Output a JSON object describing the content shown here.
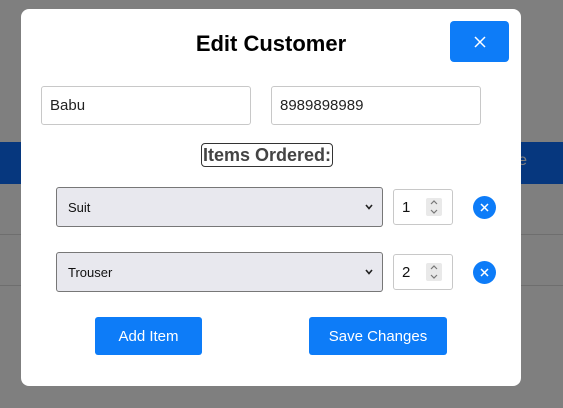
{
  "background": {
    "bar_text": "e"
  },
  "modal": {
    "title": "Edit Customer",
    "close_icon": "close-icon",
    "name_value": "Babu",
    "phone_value": "8989898989",
    "items_heading": "Items Ordered:",
    "items": [
      {
        "product": "Suit",
        "quantity": "1"
      },
      {
        "product": "Trouser",
        "quantity": "2"
      }
    ],
    "add_item_label": "Add Item",
    "save_label": "Save Changes"
  },
  "colors": {
    "accent": "#0d7cf8",
    "header_bar": "#0d6efd"
  }
}
